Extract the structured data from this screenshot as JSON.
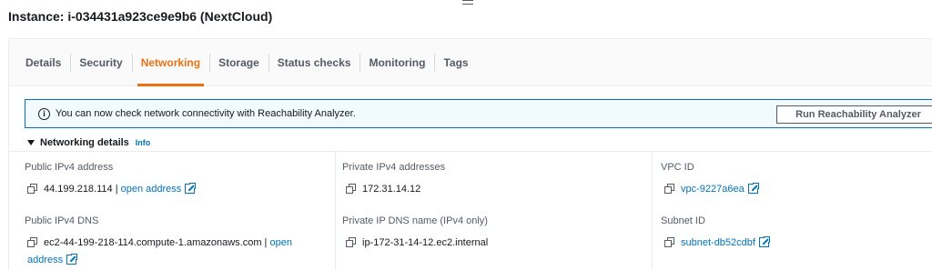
{
  "instance_title": "Instance: i-034431a923ce9e9b6 (NextCloud)",
  "tabs": [
    {
      "label": "Details",
      "active": false
    },
    {
      "label": "Security",
      "active": false
    },
    {
      "label": "Networking",
      "active": true
    },
    {
      "label": "Storage",
      "active": false
    },
    {
      "label": "Status checks",
      "active": false
    },
    {
      "label": "Monitoring",
      "active": false
    },
    {
      "label": "Tags",
      "active": false
    }
  ],
  "alert": {
    "text": "You can now check network connectivity with Reachability Analyzer.",
    "button_label": "Run Reachability Analyzer",
    "icon": "info-icon"
  },
  "section": {
    "title": "Networking details",
    "info_label": "Info"
  },
  "fields": {
    "public_ipv4": {
      "label": "Public IPv4 address",
      "value": "44.199.218.114",
      "separator": "|",
      "link": "open address"
    },
    "private_ipv4": {
      "label": "Private IPv4 addresses",
      "value": "172.31.14.12"
    },
    "vpc_id": {
      "label": "VPC ID",
      "value": "vpc-9227a6ea"
    },
    "public_dns": {
      "label": "Public IPv4 DNS",
      "value": "ec2-44-199-218-114.compute-1.amazonaws.com",
      "separator": "|",
      "link": "open address"
    },
    "private_dns": {
      "label": "Private IP DNS name (IPv4 only)",
      "value": "ip-172-31-14-12.ec2.internal"
    },
    "subnet_id": {
      "label": "Subnet ID",
      "value": "subnet-db52cdbf"
    }
  },
  "colors": {
    "accent": "#ec7211",
    "link": "#0073bb",
    "alert_bg": "#f1faff",
    "text": "#16191f",
    "muted": "#545b64"
  }
}
